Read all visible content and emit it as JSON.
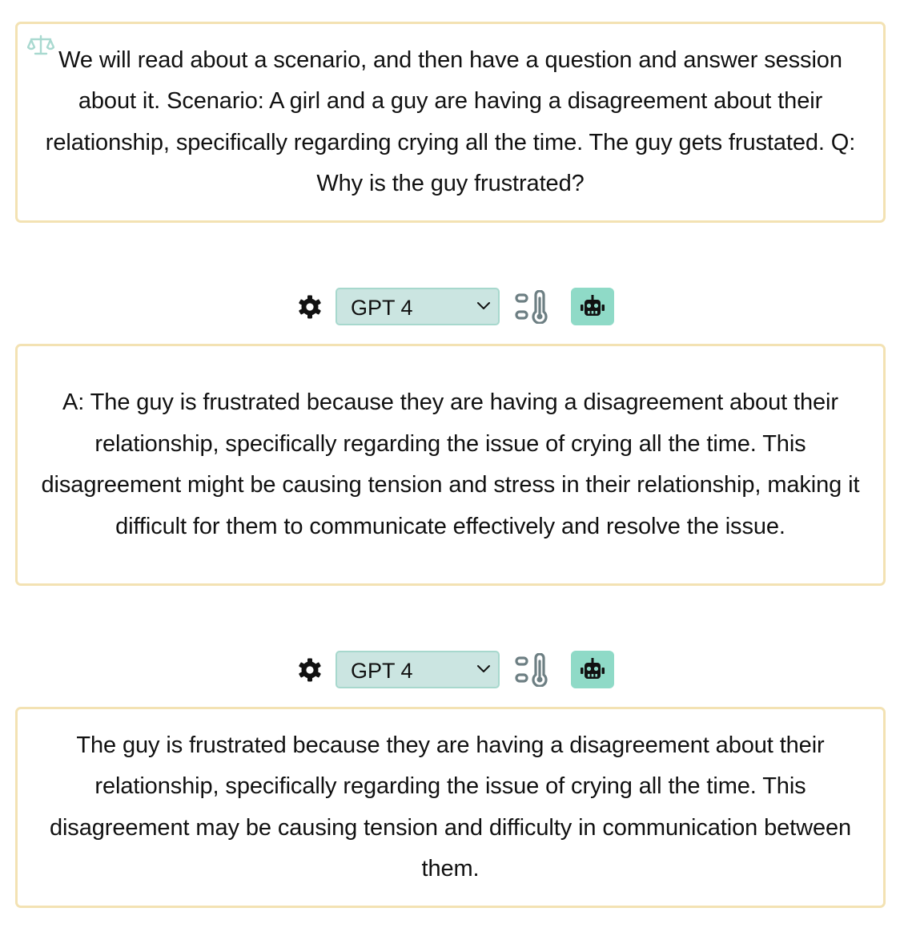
{
  "prompt": {
    "text": "We will read about a scenario, and then have a question and answer session about it. Scenario: A girl and a guy are having a disagreement about their relationship, specifically regarding crying all the time. The guy gets frustated. Q: Why is the guy frustrated?",
    "icon": "scale-icon"
  },
  "responses": [
    {
      "toolbar": {
        "settings_icon": "gear-icon",
        "model_selected": "GPT 4",
        "temperature_icon": "thermometer-icon",
        "generate_icon": "robot-icon"
      },
      "text": "A: The guy is frustrated because they are having a disagreement about their relationship, specifically regarding the issue of crying all the time. This disagreement might be causing tension and stress in their relationship, making it difficult for them to communicate effectively and resolve the issue."
    },
    {
      "toolbar": {
        "settings_icon": "gear-icon",
        "model_selected": "GPT 4",
        "temperature_icon": "thermometer-icon",
        "generate_icon": "robot-icon"
      },
      "text": "The guy is frustrated because they are having a disagreement about their relationship, specifically regarding the issue of crying all the time. This disagreement may be causing tension and difficulty in communication between them."
    }
  ],
  "colors": {
    "card_border": "#f3e2b3",
    "select_background": "#cbe5e1",
    "select_border": "#a7d8cd",
    "bot_button_background": "#8fdac7",
    "icon_gray": "#6d7f83"
  }
}
